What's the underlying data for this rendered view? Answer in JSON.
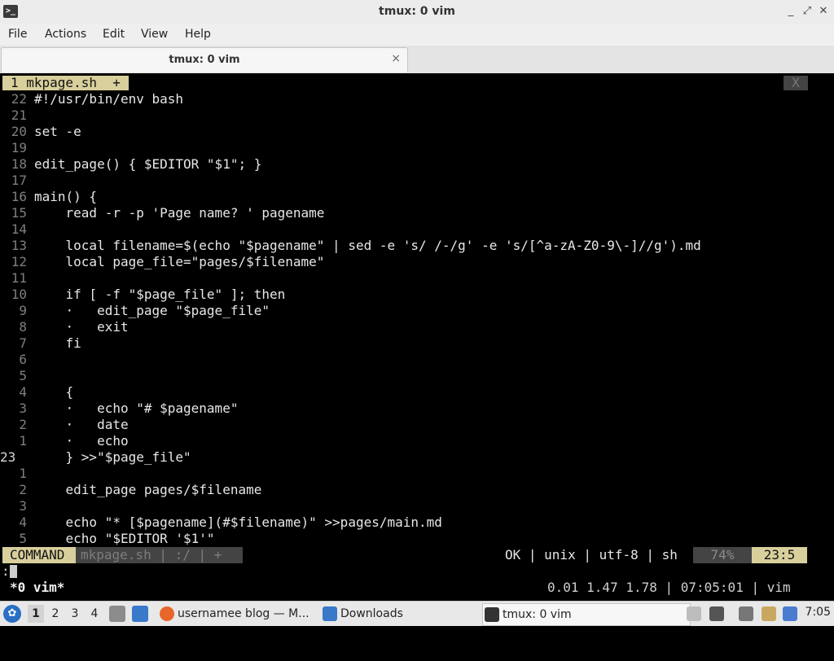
{
  "window": {
    "title": "tmux: 0 vim",
    "controls": [
      "_",
      "⤢",
      "✕"
    ]
  },
  "menu": [
    "File",
    "Actions",
    "Edit",
    "View",
    "Help"
  ],
  "tab": {
    "label": "tmux: 0 vim",
    "close": "×"
  },
  "vim": {
    "buffer_tab": "1 mkpage.sh  +",
    "buffer_close": "X",
    "lines": [
      {
        "num": "22",
        "text": "#!/usr/bin/env bash"
      },
      {
        "num": "21",
        "text": ""
      },
      {
        "num": "20",
        "text": "set -e"
      },
      {
        "num": "19",
        "text": ""
      },
      {
        "num": "18",
        "text": "edit_page() { $EDITOR \"$1\"; }"
      },
      {
        "num": "17",
        "text": ""
      },
      {
        "num": "16",
        "text": "main() {"
      },
      {
        "num": "15",
        "text": "    read -r -p 'Page name? ' pagename"
      },
      {
        "num": "14",
        "text": ""
      },
      {
        "num": "13",
        "text": "    local filename=$(echo \"$pagename\" | sed -e 's/ /-/g' -e 's/[^a-zA-Z0-9\\-]//g').md"
      },
      {
        "num": "12",
        "text": "    local page_file=\"pages/$filename\""
      },
      {
        "num": "11",
        "text": ""
      },
      {
        "num": "10",
        "text": "    if [ -f \"$page_file\" ]; then"
      },
      {
        "num": "9",
        "text": "    ·   edit_page \"$page_file\""
      },
      {
        "num": "8",
        "text": "    ·   exit"
      },
      {
        "num": "7",
        "text": "    fi"
      },
      {
        "num": "6",
        "text": ""
      },
      {
        "num": "5",
        "text": ""
      },
      {
        "num": "4",
        "text": "    {"
      },
      {
        "num": "3",
        "text": "    ·   echo \"# $pagename\""
      },
      {
        "num": "2",
        "text": "    ·   date"
      },
      {
        "num": "1",
        "text": "    ·   echo"
      },
      {
        "num": "23",
        "text": "    } >>\"$page_file\"",
        "current": true
      },
      {
        "num": "1",
        "text": ""
      },
      {
        "num": "2",
        "text": "    edit_page pages/$filename"
      },
      {
        "num": "3",
        "text": ""
      },
      {
        "num": "4",
        "text": "    echo \"* [$pagename](#$filename)\" >>pages/main.md"
      },
      {
        "num": "5",
        "text": "    echo \"$EDITOR '$1'\""
      }
    ],
    "status": {
      "mode": "COMMAND",
      "file": "mkpage.sh | :/ | +",
      "right": "OK | unix | utf-8 | sh",
      "percent": "74%",
      "position": "23:5"
    },
    "cmdline": ":"
  },
  "tmux": {
    "window": "*0 vim*",
    "right": "0.01 1.47 1.78 | 07:05:01 | vim"
  },
  "taskbar": {
    "workspaces": [
      "1",
      "2",
      "3",
      "4"
    ],
    "tasks": [
      {
        "label": "usernamee blog — M...",
        "icon": "firefox-icon"
      },
      {
        "label": "Downloads",
        "icon": "folder-icon"
      },
      {
        "label": "tmux: 0 vim",
        "icon": "terminal-icon"
      }
    ],
    "clock": "7:05",
    "colors": {
      "start": "#2a6fc4",
      "firefox": "#e8662c",
      "folder": "#3a78c9"
    }
  }
}
